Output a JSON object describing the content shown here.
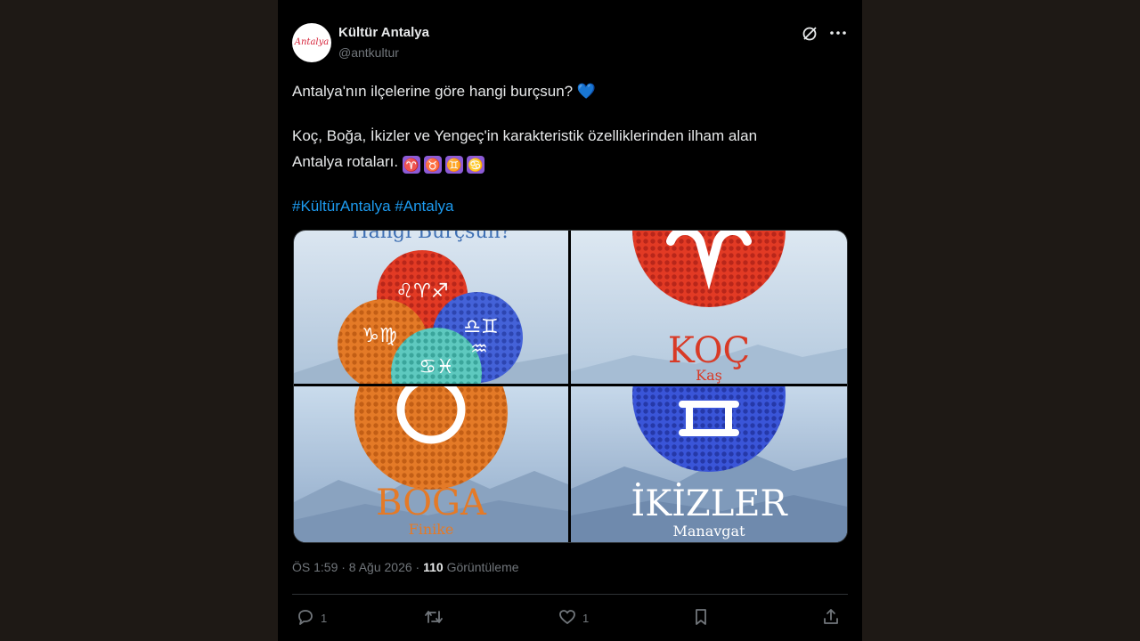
{
  "account": {
    "name": "Kültür Antalya",
    "handle": "@antkultur",
    "avatar_text": "Antalya"
  },
  "tweet": {
    "line1": "Antalya'nın ilçelerine göre hangi burçsun?",
    "line2": "Koç, Boğa, İkizler ve Yengeç'in karakteristik özelliklerinden ilham alan",
    "line3": "Antalya rotaları.",
    "emoji_heart": "💙",
    "zodiac_emojis": [
      "♈",
      "♉",
      "♊",
      "♋"
    ],
    "hashtags": [
      "#KültürAntalya",
      "#Antalya"
    ]
  },
  "media": {
    "tile1_heading": "Hangi Burçsun?",
    "tile2_sign": "KOÇ",
    "tile2_district": "Kaş",
    "tile3_sign": "BOĞA",
    "tile3_district": "Finike",
    "tile4_sign": "İKİZLER",
    "tile4_district": "Manavgat"
  },
  "meta": {
    "time": "ÖS 1:59 · 8 Ağu 2026 ·",
    "views_count": "110",
    "views_label": "Görüntüleme"
  },
  "actions": {
    "reply_count": "1",
    "retweet_count": "",
    "like_count": "1"
  },
  "colors": {
    "background": "#000000",
    "page_side": "#1e1915",
    "text": "#e7e9ea",
    "secondary": "#71767b",
    "link": "#1d9bf0",
    "aries_red": "#e8402a",
    "taurus_orange": "#e47a27",
    "gemini_blue": "#3a55d8"
  }
}
